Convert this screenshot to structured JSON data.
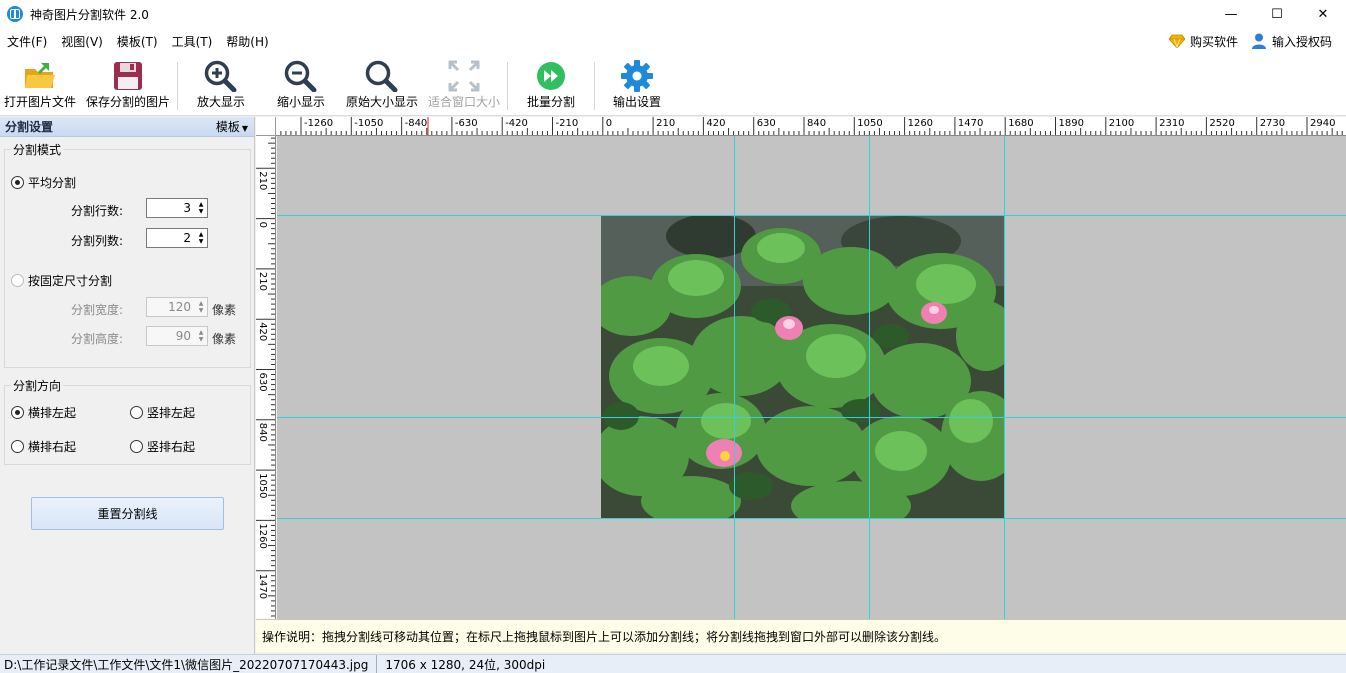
{
  "window": {
    "title": "神奇图片分割软件 2.0",
    "controls": {
      "minimize": "—",
      "maximize": "☐",
      "close": "✕"
    }
  },
  "menu": {
    "items": [
      "文件(F)",
      "视图(V)",
      "模板(T)",
      "工具(T)",
      "帮助(H)"
    ],
    "buy": "购买软件",
    "license": "输入授权码"
  },
  "toolbar": {
    "open": "打开图片文件",
    "save": "保存分割的图片",
    "zoom_in": "放大显示",
    "zoom_out": "缩小显示",
    "original_size": "原始大小显示",
    "fit_window": "适合窗口大小",
    "batch": "批量分割",
    "output_settings": "输出设置"
  },
  "left_panel": {
    "title": "分割设置",
    "template_menu": "模板",
    "mode_group": {
      "title": "分割模式",
      "even_split": "平均分割",
      "rows_label": "分割行数:",
      "rows_value": "3",
      "cols_label": "分割列数:",
      "cols_value": "2",
      "fixed_size": "按固定尺寸分割",
      "width_label": "分割宽度:",
      "width_value": "120",
      "height_label": "分割高度:",
      "height_value": "90",
      "unit": "像素"
    },
    "direction_group": {
      "title": "分割方向",
      "h_left": "横排左起",
      "v_left": "竖排左起",
      "h_right": "横排右起",
      "v_right": "竖排右起"
    },
    "reset_button": "重置分割线"
  },
  "rulers": {
    "h_labels": [
      "-1260",
      "-1050",
      "-840",
      "-630",
      "-420",
      "-210",
      "0",
      "210",
      "420",
      "630",
      "840",
      "1050",
      "1260",
      "1470",
      "1680",
      "1890",
      "2100",
      "2310",
      "2520",
      "2730",
      "2940"
    ],
    "v_labels": [
      "0",
      "210",
      "0",
      "210",
      "420",
      "630",
      "840",
      "1050",
      "1260",
      "1470"
    ]
  },
  "hint": "操作说明：拖拽分割线可移动其位置；在标尺上拖拽鼠标到图片上可以添加分割线；将分割线拖拽到窗口外部可以删除该分割线。",
  "status": {
    "path": "D:\\工作记录文件\\工作文件\\文件1\\微信图片_20220707170443.jpg",
    "info": "1706 x 1280, 24位, 300dpi"
  },
  "colors": {
    "guide_line": "#36d0d8",
    "canvas_bg": "#c3c3c3",
    "hint_bg": "#fefee8",
    "accent_blue": "#1e8ad8",
    "batch_green": "#2fbf5f"
  }
}
